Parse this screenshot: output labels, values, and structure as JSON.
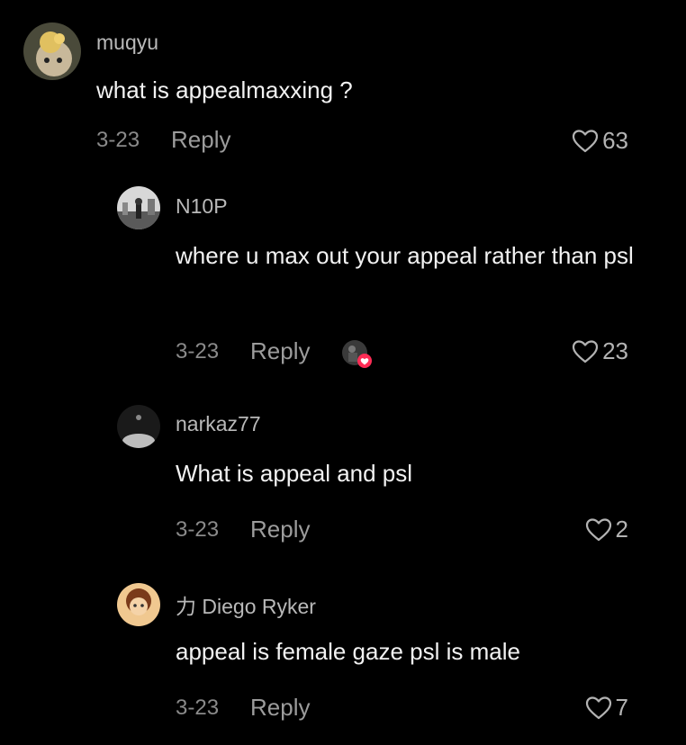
{
  "comments": [
    {
      "username": "muqyu",
      "text": "what is appealmaxxing ?",
      "date": "3-23",
      "reply": "Reply",
      "likes": "63",
      "avatar": "cat-avatar"
    },
    {
      "username": "N10P",
      "text": "where u max out your appeal rather than psl",
      "date": "3-23",
      "reply": "Reply",
      "likes": "23",
      "avatar": "street-photo-avatar",
      "creator_liked": true
    },
    {
      "username": "narkaz77",
      "text": "What is appeal and psl",
      "date": "3-23",
      "reply": "Reply",
      "likes": "2",
      "avatar": "dark-moon-avatar"
    },
    {
      "username": "力 Diego Ryker",
      "text": "appeal is female gaze psl is male",
      "date": "3-23",
      "reply": "Reply",
      "likes": "7",
      "avatar": "anime-avatar"
    }
  ],
  "icons": {
    "like": "heart-outline-icon",
    "creator_like": "red-heart-badge-icon"
  },
  "colors": {
    "background": "#000000",
    "accent_red": "#fe2c55"
  }
}
